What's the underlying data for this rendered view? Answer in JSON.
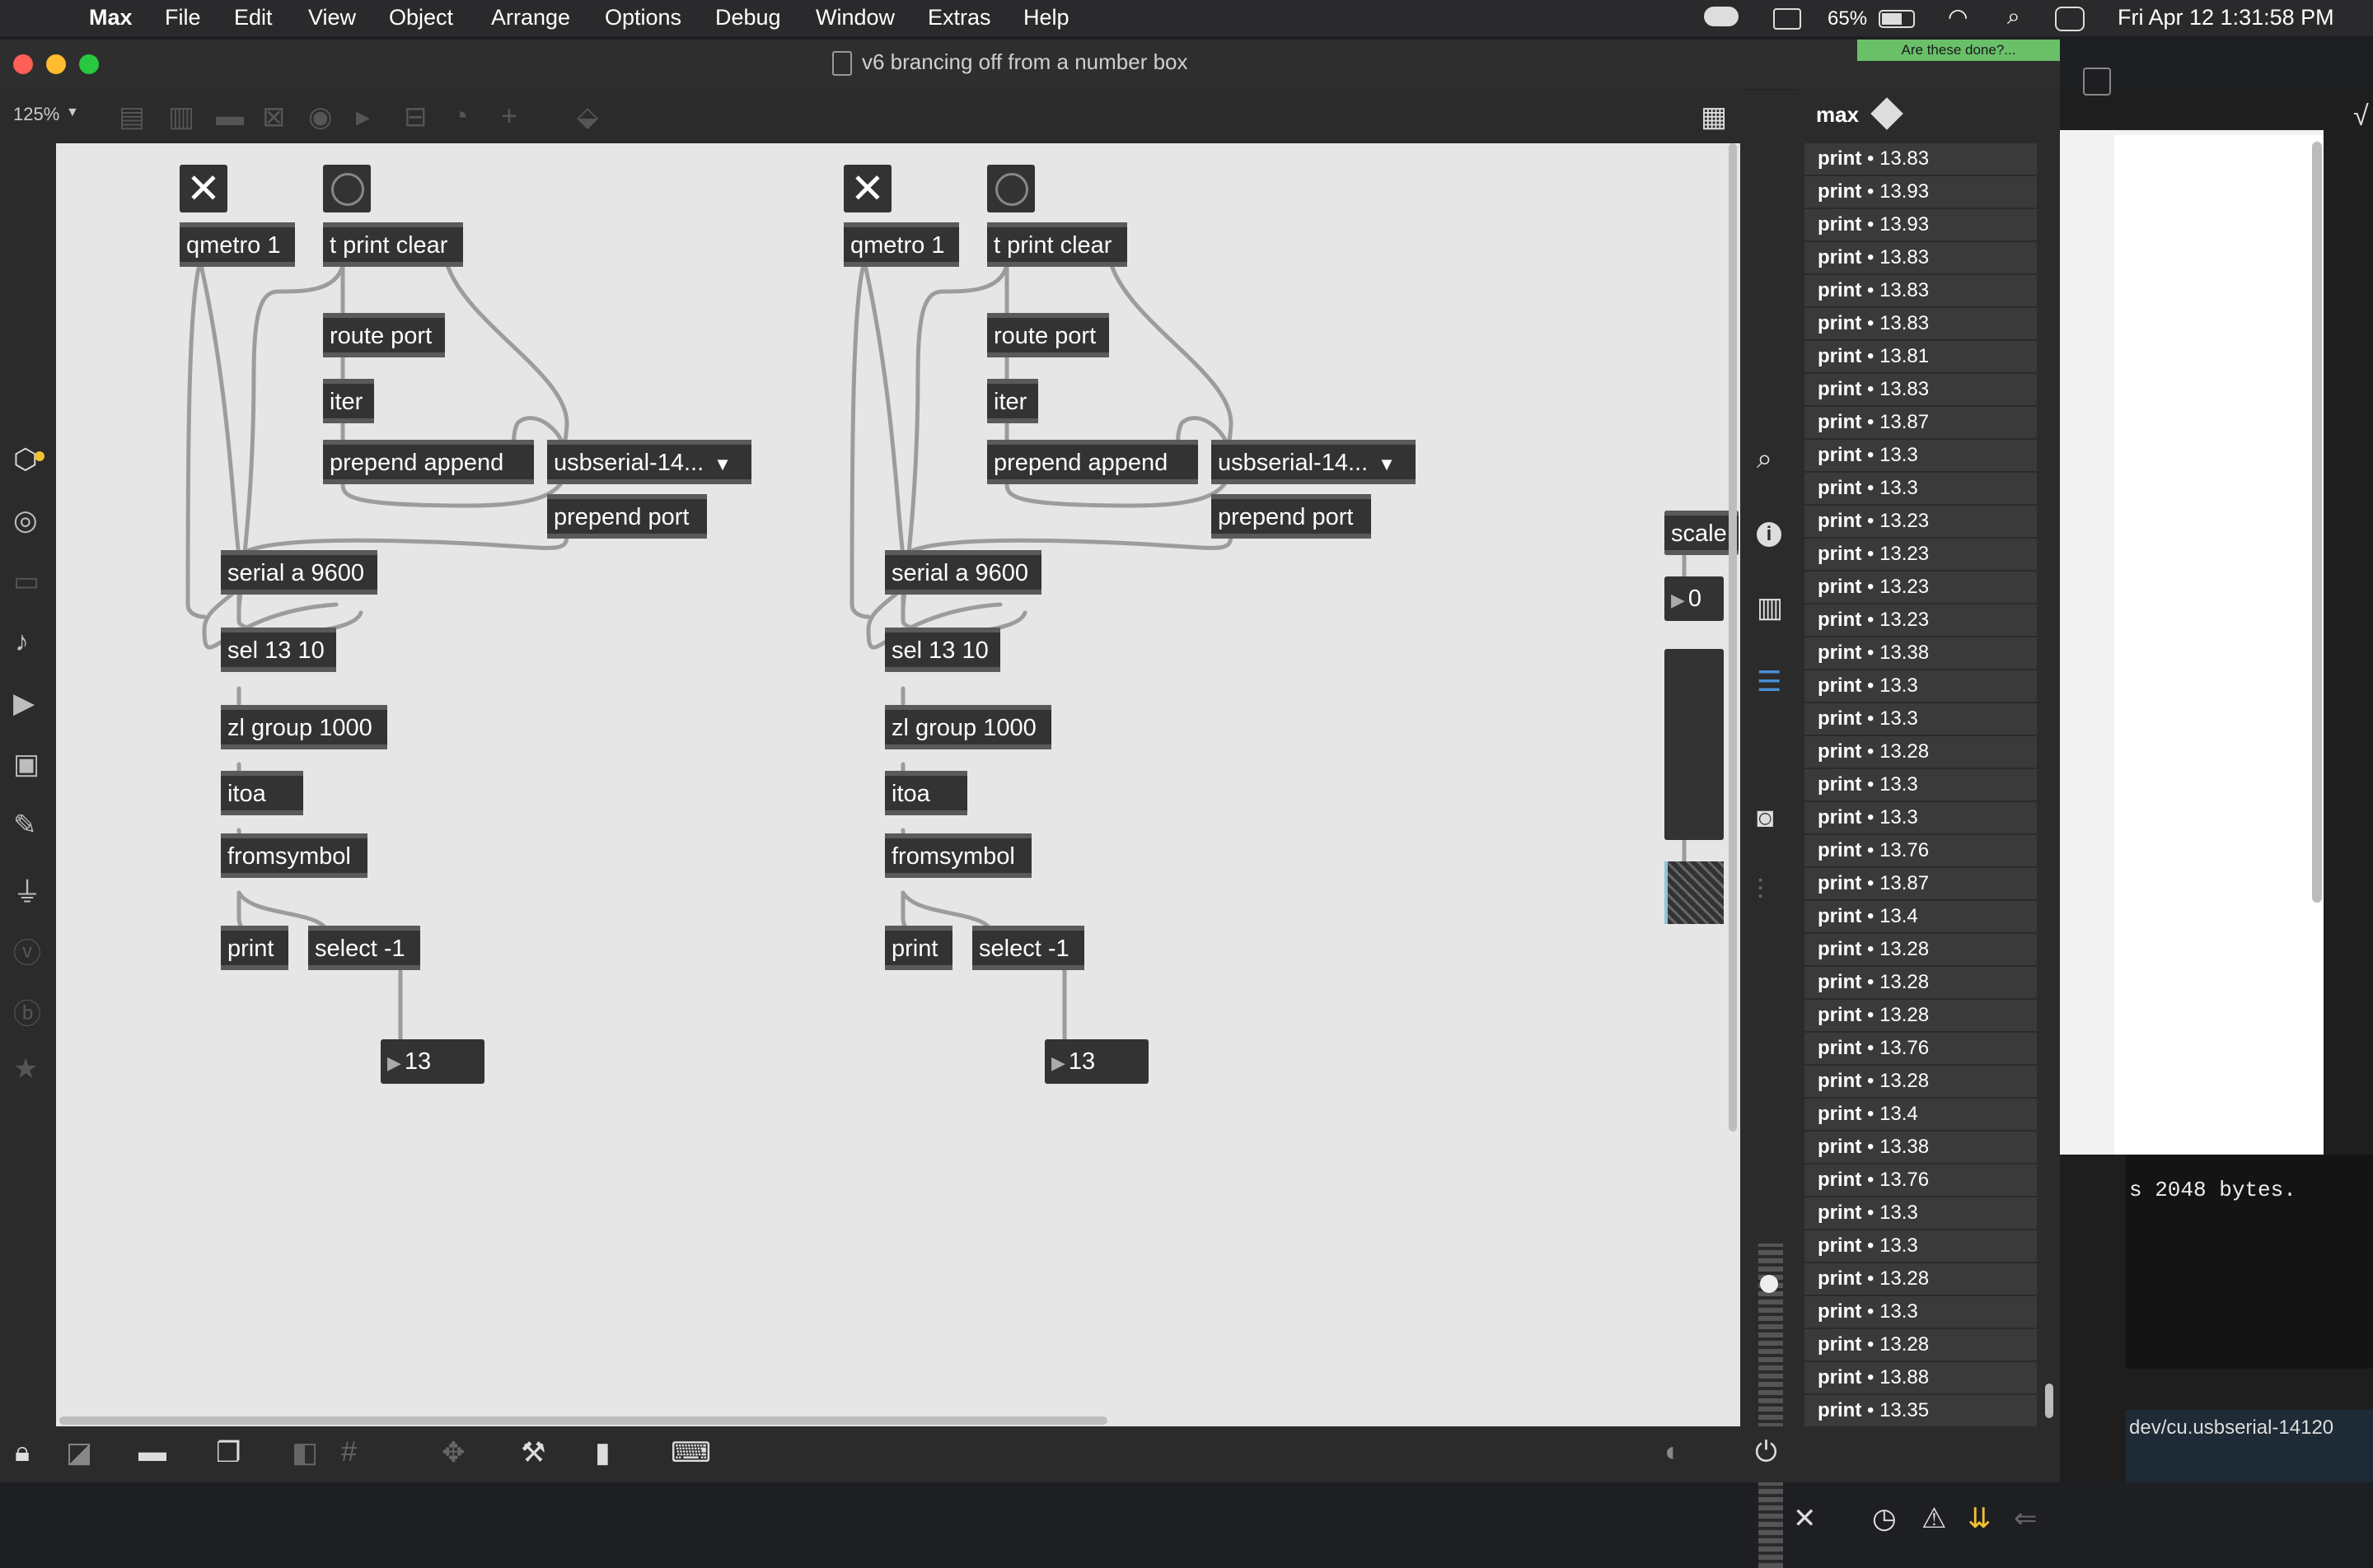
{
  "menubar": {
    "app": "Max",
    "items": [
      "File",
      "Edit",
      "View",
      "Object",
      "Arrange",
      "Options",
      "Debug",
      "Window",
      "Extras",
      "Help"
    ],
    "battery": "65%",
    "clock": "Fri Apr 12  1:31:58 PM"
  },
  "window": {
    "title": "v6 brancing off from a number box",
    "notice": "Are these done?..."
  },
  "toolbar": {
    "zoom": "125%"
  },
  "patch_left": {
    "qmetro": "qmetro 1",
    "tprint": "t print clear",
    "route": "route port",
    "iter": "iter",
    "prepend_append": "prepend append",
    "menu": "usbserial-14...",
    "prepend_port": "prepend port",
    "serial": "serial a 9600",
    "sel": "sel 13 10",
    "zl": "zl group 1000",
    "itoa": "itoa",
    "fromsymbol": "fromsymbol",
    "print": "print",
    "select": "select -1",
    "number": "13"
  },
  "patch_right": {
    "qmetro": "qmetro 1",
    "tprint": "t print clear",
    "route": "route port",
    "iter": "iter",
    "prepend_append": "prepend append",
    "menu": "usbserial-14...",
    "prepend_port": "prepend port",
    "serial": "serial a 9600",
    "sel": "sel 13 10",
    "zl": "zl group 1000",
    "itoa": "itoa",
    "fromsymbol": "fromsymbol",
    "print": "print",
    "select": "select -1",
    "number": "13"
  },
  "edge": {
    "scale": "scale",
    "number": "0"
  },
  "console": {
    "title": "max",
    "rows": [
      {
        "k": "print",
        "v": "• 13.83"
      },
      {
        "k": "print",
        "v": "• 13.93"
      },
      {
        "k": "print",
        "v": "• 13.93"
      },
      {
        "k": "print",
        "v": "• 13.83"
      },
      {
        "k": "print",
        "v": "• 13.83"
      },
      {
        "k": "print",
        "v": "• 13.83"
      },
      {
        "k": "print",
        "v": "• 13.81"
      },
      {
        "k": "print",
        "v": "• 13.83"
      },
      {
        "k": "print",
        "v": "• 13.87"
      },
      {
        "k": "print",
        "v": "• 13.3"
      },
      {
        "k": "print",
        "v": "• 13.3"
      },
      {
        "k": "print",
        "v": "• 13.23"
      },
      {
        "k": "print",
        "v": "• 13.23"
      },
      {
        "k": "print",
        "v": "• 13.23"
      },
      {
        "k": "print",
        "v": "• 13.23"
      },
      {
        "k": "print",
        "v": "• 13.38"
      },
      {
        "k": "print",
        "v": "• 13.3"
      },
      {
        "k": "print",
        "v": "• 13.3"
      },
      {
        "k": "print",
        "v": "• 13.28"
      },
      {
        "k": "print",
        "v": "• 13.3"
      },
      {
        "k": "print",
        "v": "• 13.3"
      },
      {
        "k": "print",
        "v": "• 13.76"
      },
      {
        "k": "print",
        "v": "• 13.87"
      },
      {
        "k": "print",
        "v": "• 13.4"
      },
      {
        "k": "print",
        "v": "• 13.28"
      },
      {
        "k": "print",
        "v": "• 13.28"
      },
      {
        "k": "print",
        "v": "• 13.28"
      },
      {
        "k": "print",
        "v": "• 13.76"
      },
      {
        "k": "print",
        "v": "• 13.28"
      },
      {
        "k": "print",
        "v": "• 13.4"
      },
      {
        "k": "print",
        "v": "• 13.38"
      },
      {
        "k": "print",
        "v": "• 13.76"
      },
      {
        "k": "print",
        "v": "• 13.3"
      },
      {
        "k": "print",
        "v": "• 13.3"
      },
      {
        "k": "print",
        "v": "• 13.28"
      },
      {
        "k": "print",
        "v": "• 13.3"
      },
      {
        "k": "print",
        "v": "• 13.28"
      },
      {
        "k": "print",
        "v": "• 13.88"
      },
      {
        "k": "print",
        "v": "• 13.35"
      }
    ]
  },
  "terminal": {
    "line": "s 2048 bytes.",
    "status": "dev/cu.usbserial-14120"
  }
}
